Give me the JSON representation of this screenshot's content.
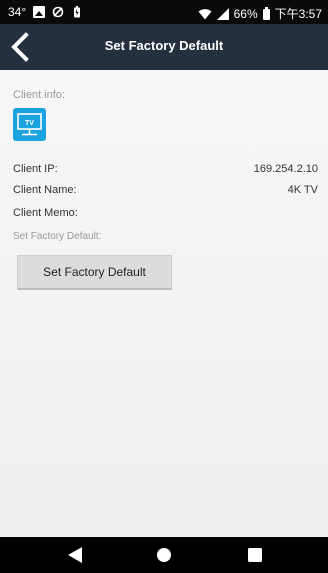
{
  "status_bar": {
    "temperature": "34°",
    "battery_percent": "66%",
    "time": "下午3:57",
    "left_icons": [
      "image-icon",
      "sync-icon",
      "battery-saver-icon"
    ],
    "right_icons": [
      "wifi-icon",
      "signal-icon",
      "battery-icon"
    ]
  },
  "app_bar": {
    "title": "Set Factory Default",
    "back_icon": "chevron-left-icon"
  },
  "content": {
    "client_info_label": "Client info:",
    "tv_icon_text": "TV",
    "client_ip_label": "Client IP:",
    "client_ip_value": "169.254.2.10",
    "client_name_label": "Client Name:",
    "client_name_value": "4K TV",
    "client_memo_label": "Client Memo:",
    "client_memo_value": "",
    "set_factory_default_label": "Set Factory Default:",
    "set_factory_default_button": "Set Factory Default"
  },
  "nav_bar": {
    "buttons": [
      "back-triangle-icon",
      "home-circle-icon",
      "recents-square-icon"
    ]
  },
  "colors": {
    "app_bar": "#25303f",
    "tv_icon": "#1ba3e0",
    "button_bg": "#dcdcdc",
    "status_bar": "#0a0a0a"
  }
}
